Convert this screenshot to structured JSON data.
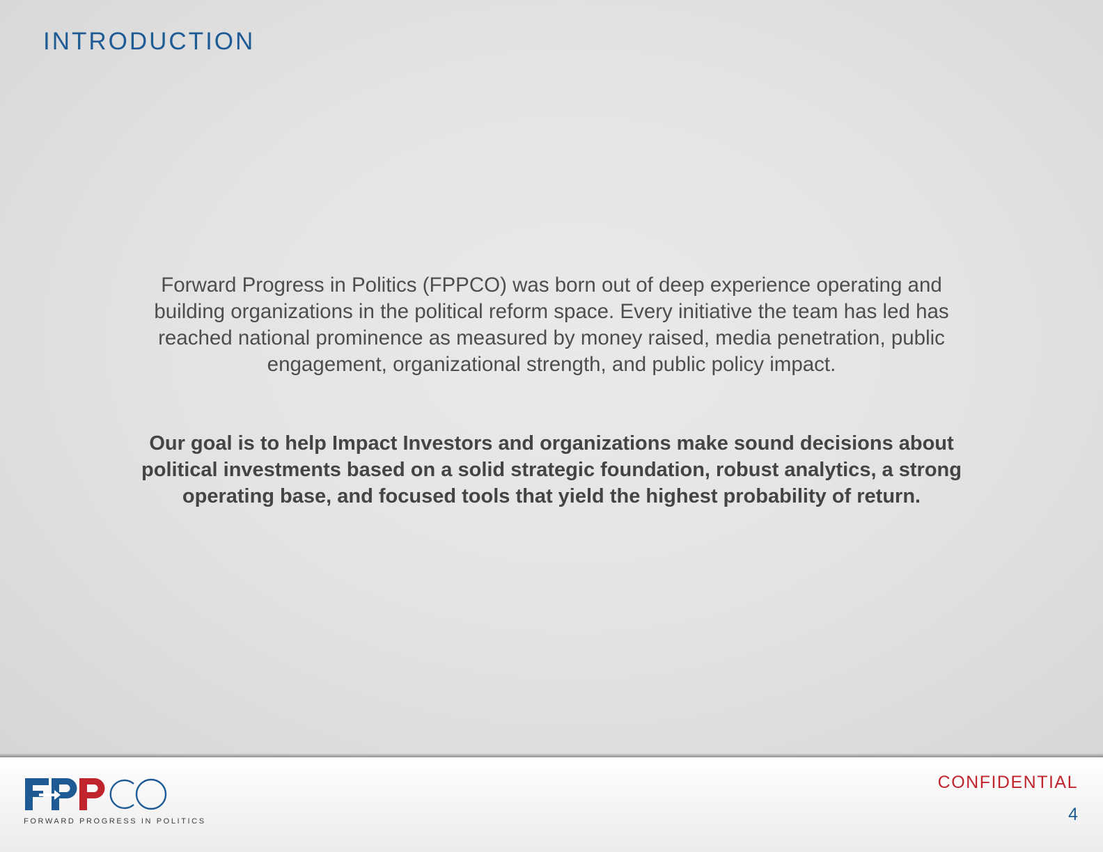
{
  "header": {
    "title": "INTRODUCTION"
  },
  "main": {
    "intro_text": "Forward Progress in Politics  (FPPCO) was born out of deep experience operating and building organizations in the political reform space. Every initiative the team has led has reached national prominence as measured by money raised, media penetration, public engagement, organizational strength, and public policy impact.",
    "goal_text": "Our goal is to help Impact Investors and organizations make sound decisions about political investments based on a solid strategic foundation, robust analytics, a strong operating base, and focused tools that yield the highest probability of return."
  },
  "footer": {
    "logo_text": "FPPCO",
    "logo_tagline": "FORWARD PROGRESS IN POLITICS",
    "confidential_label": "CONFIDENTIAL",
    "page_number": "4"
  },
  "colors": {
    "title_blue": "#1e5b94",
    "logo_red": "#c0252d",
    "body_text": "#4d4d4d"
  }
}
